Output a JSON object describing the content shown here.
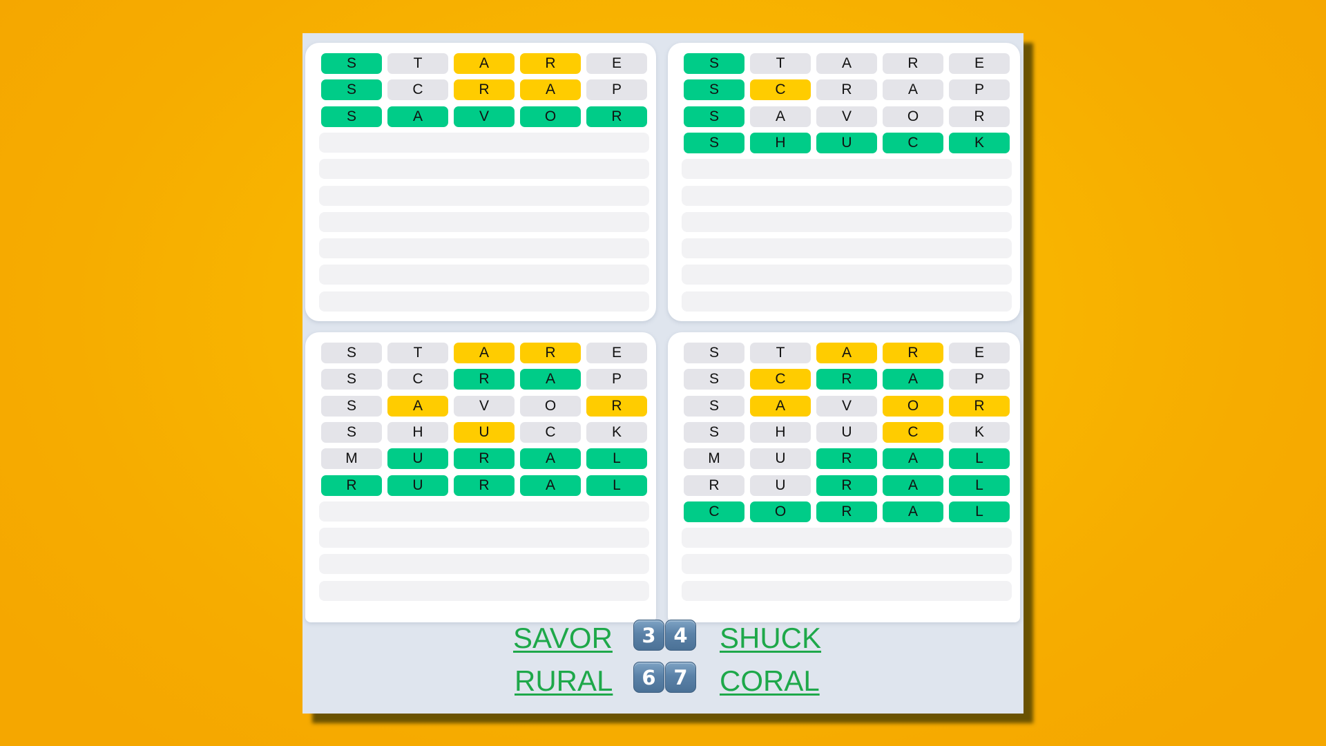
{
  "game": "Quordle",
  "colors": {
    "correct": "#00cc88",
    "present": "#ffcc00",
    "absent": "#e4e4e9",
    "empty_row": "#f2f2f4",
    "answer_text": "#1ea84a",
    "panel": "#dfe5ee"
  },
  "boards": [
    {
      "name": "top-left",
      "answer": "SAVOR",
      "solved_in": 3,
      "guesses": [
        {
          "word": "STARE",
          "letters": [
            "S",
            "T",
            "A",
            "R",
            "E"
          ],
          "states": [
            "g",
            "n",
            "y",
            "y",
            "n"
          ]
        },
        {
          "word": "SCRAP",
          "letters": [
            "S",
            "C",
            "R",
            "A",
            "P"
          ],
          "states": [
            "g",
            "n",
            "y",
            "y",
            "n"
          ]
        },
        {
          "word": "SAVOR",
          "letters": [
            "S",
            "A",
            "V",
            "O",
            "R"
          ],
          "states": [
            "g",
            "g",
            "g",
            "g",
            "g"
          ]
        }
      ],
      "empty_rows": 7
    },
    {
      "name": "top-right",
      "answer": "SHUCK",
      "solved_in": 4,
      "guesses": [
        {
          "word": "STARE",
          "letters": [
            "S",
            "T",
            "A",
            "R",
            "E"
          ],
          "states": [
            "g",
            "n",
            "n",
            "n",
            "n"
          ]
        },
        {
          "word": "SCRAP",
          "letters": [
            "S",
            "C",
            "R",
            "A",
            "P"
          ],
          "states": [
            "g",
            "y",
            "n",
            "n",
            "n"
          ]
        },
        {
          "word": "SAVOR",
          "letters": [
            "S",
            "A",
            "V",
            "O",
            "R"
          ],
          "states": [
            "g",
            "n",
            "n",
            "n",
            "n"
          ]
        },
        {
          "word": "SHUCK",
          "letters": [
            "S",
            "H",
            "U",
            "C",
            "K"
          ],
          "states": [
            "g",
            "g",
            "g",
            "g",
            "g"
          ]
        }
      ],
      "empty_rows": 6
    },
    {
      "name": "bottom-left",
      "answer": "RURAL",
      "solved_in": 6,
      "guesses": [
        {
          "word": "STARE",
          "letters": [
            "S",
            "T",
            "A",
            "R",
            "E"
          ],
          "states": [
            "n",
            "n",
            "y",
            "y",
            "n"
          ]
        },
        {
          "word": "SCRAP",
          "letters": [
            "S",
            "C",
            "R",
            "A",
            "P"
          ],
          "states": [
            "n",
            "n",
            "g",
            "g",
            "n"
          ]
        },
        {
          "word": "SAVOR",
          "letters": [
            "S",
            "A",
            "V",
            "O",
            "R"
          ],
          "states": [
            "n",
            "y",
            "n",
            "n",
            "y"
          ]
        },
        {
          "word": "SHUCK",
          "letters": [
            "S",
            "H",
            "U",
            "C",
            "K"
          ],
          "states": [
            "n",
            "n",
            "y",
            "n",
            "n"
          ]
        },
        {
          "word": "MURAL",
          "letters": [
            "M",
            "U",
            "R",
            "A",
            "L"
          ],
          "states": [
            "n",
            "g",
            "g",
            "g",
            "g"
          ]
        },
        {
          "word": "RURAL",
          "letters": [
            "R",
            "U",
            "R",
            "A",
            "L"
          ],
          "states": [
            "g",
            "g",
            "g",
            "g",
            "g"
          ]
        }
      ],
      "empty_rows": 4
    },
    {
      "name": "bottom-right",
      "answer": "CORAL",
      "solved_in": 7,
      "guesses": [
        {
          "word": "STARE",
          "letters": [
            "S",
            "T",
            "A",
            "R",
            "E"
          ],
          "states": [
            "n",
            "n",
            "y",
            "y",
            "n"
          ]
        },
        {
          "word": "SCRAP",
          "letters": [
            "S",
            "C",
            "R",
            "A",
            "P"
          ],
          "states": [
            "n",
            "y",
            "g",
            "g",
            "n"
          ]
        },
        {
          "word": "SAVOR",
          "letters": [
            "S",
            "A",
            "V",
            "O",
            "R"
          ],
          "states": [
            "n",
            "y",
            "n",
            "y",
            "y"
          ]
        },
        {
          "word": "SHUCK",
          "letters": [
            "S",
            "H",
            "U",
            "C",
            "K"
          ],
          "states": [
            "n",
            "n",
            "n",
            "y",
            "n"
          ]
        },
        {
          "word": "MURAL",
          "letters": [
            "M",
            "U",
            "R",
            "A",
            "L"
          ],
          "states": [
            "n",
            "n",
            "g",
            "g",
            "g"
          ]
        },
        {
          "word": "RURAL",
          "letters": [
            "R",
            "U",
            "R",
            "A",
            "L"
          ],
          "states": [
            "n",
            "n",
            "g",
            "g",
            "g"
          ]
        },
        {
          "word": "CORAL",
          "letters": [
            "C",
            "O",
            "R",
            "A",
            "L"
          ],
          "states": [
            "g",
            "g",
            "g",
            "g",
            "g"
          ]
        }
      ],
      "empty_rows": 3
    }
  ],
  "summary": {
    "row1": {
      "left_word": "SAVOR",
      "keycaps": [
        "3",
        "4"
      ],
      "right_word": "SHUCK"
    },
    "row2": {
      "left_word": "RURAL",
      "keycaps": [
        "6",
        "7"
      ],
      "right_word": "CORAL"
    }
  }
}
